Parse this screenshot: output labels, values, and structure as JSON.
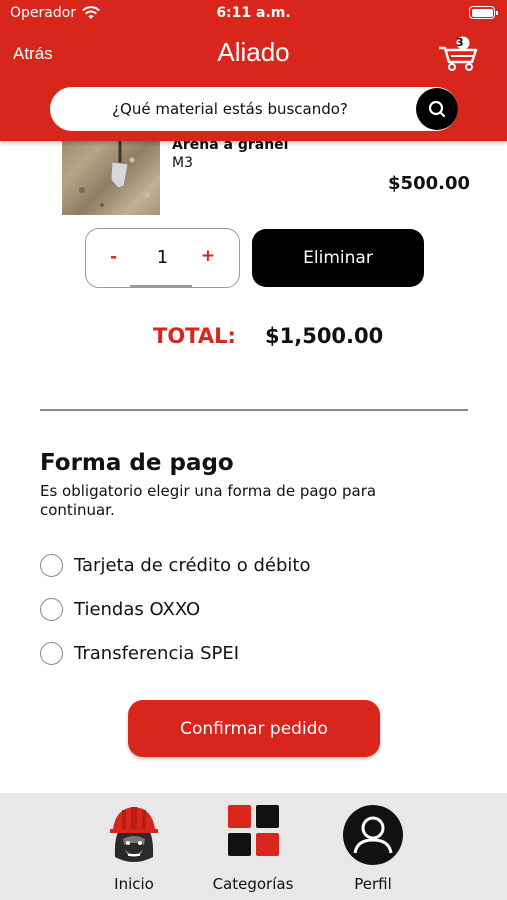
{
  "status_bar": {
    "carrier": "Operador",
    "time": "6:11 a.m."
  },
  "header": {
    "back_label": "Atrás",
    "title": "Aliado",
    "cart_count": "3"
  },
  "search": {
    "placeholder": "¿Qué material estás buscando?"
  },
  "cart_item": {
    "name": "Arena a granel",
    "unit": "M3",
    "price": "$500.00",
    "quantity": "1",
    "minus_label": "-",
    "plus_label": "+",
    "delete_label": "Eliminar"
  },
  "total": {
    "label": "TOTAL:",
    "value": "$1,500.00"
  },
  "payment": {
    "title": "Forma de pago",
    "subtitle": "Es obligatorio elegir una forma de pago para continuar.",
    "options": [
      {
        "label": "Tarjeta de crédito o débito"
      },
      {
        "label": "Tiendas OXXO"
      },
      {
        "label": "Transferencia SPEI"
      }
    ],
    "confirm_label": "Confirmar pedido"
  },
  "tabs": [
    {
      "label": "Inicio",
      "icon": "gorilla-helmet-icon"
    },
    {
      "label": "Categorías",
      "icon": "grid-icon"
    },
    {
      "label": "Perfil",
      "icon": "user-icon"
    }
  ],
  "colors": {
    "brand_red": "#d9261c",
    "black": "#000000",
    "tabbar_bg": "#e8e8e8"
  }
}
